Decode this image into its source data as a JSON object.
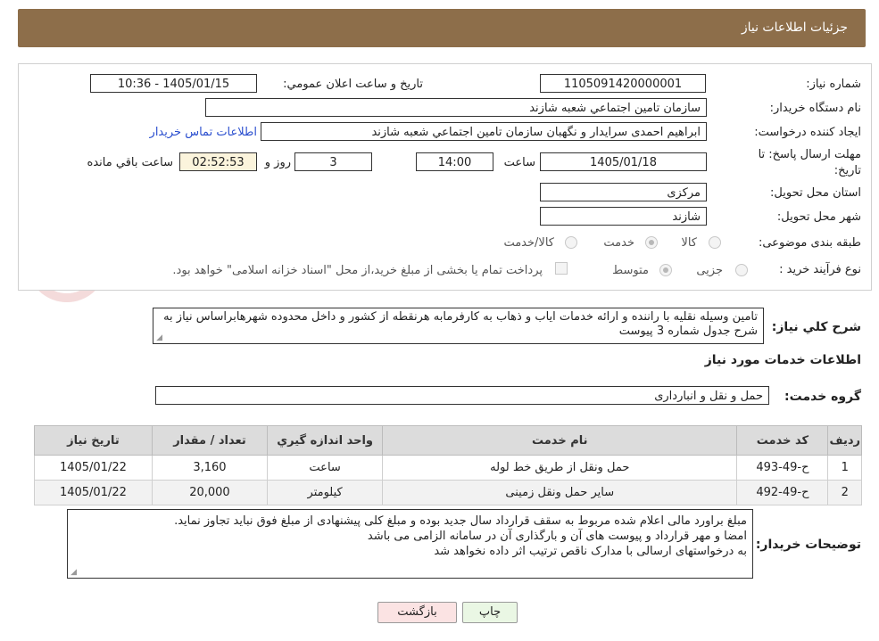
{
  "header": {
    "title": "جزئیات اطلاعات نیاز"
  },
  "form": {
    "need_number_label": "شماره نیاز:",
    "need_number": "1105091420000001",
    "announce_datetime_label": "تاریخ و ساعت اعلان عمومي:",
    "announce_datetime": "1405/01/15 - 10:36",
    "buyer_org_label": "نام دستگاه خريدار:",
    "buyer_org": "سازمان تامين اجتماعي شعبه شازند",
    "requester_label": "ايجاد کننده درخواست:",
    "requester": "ابراهيم  احمدی سرايدار و نگهبان  سازمان تامين اجتماعي شعبه شازند",
    "contact_link": "اطلاعات تماس خریدار",
    "deadline_label_line1": "مهلت ارسال پاسخ: تا",
    "deadline_label_line2": "تاریخ:",
    "deadline_date": "1405/01/18",
    "time_label": "ساعت",
    "deadline_time": "14:00",
    "days": "3",
    "days_label": "روز و",
    "remaining_time": "02:52:53",
    "remaining_label": "ساعت باقي مانده",
    "province_label": "استان محل تحویل:",
    "province": "مرکزی",
    "city_label": "شهر محل تحویل:",
    "city": "شازند",
    "category_label": "طبقه بندی موضوعی:",
    "category_options": [
      "کالا",
      "خدمت",
      "کالا/خدمت"
    ],
    "category_selected": "خدمت",
    "purchase_type_label": "نوع فرآيند خريد :",
    "purchase_options": [
      "جزیی",
      "متوسط"
    ],
    "purchase_selected": "متوسط",
    "payment_note": "پرداخت تمام یا بخشی از مبلغ خرید،از محل \"اسناد خزانه اسلامی\" خواهد بود."
  },
  "description": {
    "label": "شرح کلي نياز:",
    "text": "تامین وسیله نقلیه با راننده و ارائه خدمات ایاب و ذهاب به کارفرمابه هرنقطه از کشور و داخل محدوده شهرهابراساس نیاز به شرح جدول شماره 3 پیوست"
  },
  "services_section": {
    "title": "اطلاعات خدمات مورد نياز",
    "group_label": "گروه خدمت:",
    "group_value": "حمل و نقل و انبارداری"
  },
  "table": {
    "headers": [
      "رديف",
      "کد خدمت",
      "نام خدمت",
      "واحد اندازه گيري",
      "تعداد / مقدار",
      "تاريخ نياز"
    ],
    "rows": [
      [
        "1",
        "ح-49-493",
        "حمل ونقل از طریق خط لوله",
        "ساعت",
        "3,160",
        "1405/01/22"
      ],
      [
        "2",
        "ح-49-492",
        "سایر حمل ونقل زمینی",
        "کیلومتر",
        "20,000",
        "1405/01/22"
      ]
    ]
  },
  "buyer_notes": {
    "label": "توضيحات خريدار:",
    "lines": [
      "مبلغ براورد مالی اعلام شده مربوط به سقف قرارداد سال جدید بوده و مبلغ کلی پیشنهادی از مبلغ فوق نباید تجاوز نماید.",
      "امضا و مهر قرارداد و پیوست های آن و بارگذاری آن در سامانه الزامی می باشد",
      "به درخواستهای ارسالی با مدارک ناقص ترتیب اثر داده نخواهد شد"
    ]
  },
  "buttons": {
    "print": "چاپ",
    "back": "بازگشت"
  },
  "watermark": {
    "text": "AriaTender.neT"
  },
  "colors": {
    "header_bg": "#8d6e4a",
    "link": "#2b4fcf",
    "print_bg": "#eaf7e4",
    "back_bg": "#fbe3e3"
  }
}
